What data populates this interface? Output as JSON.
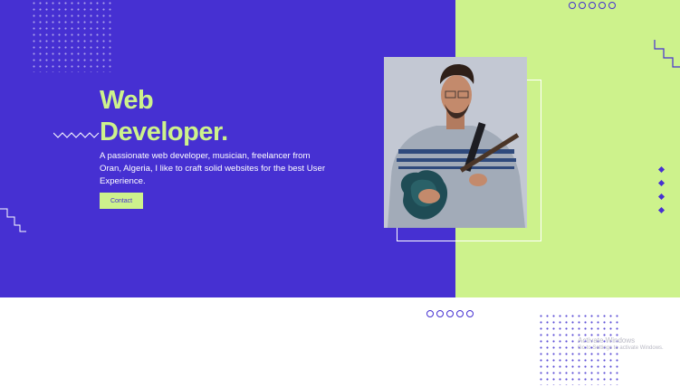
{
  "hero": {
    "title_line1": "Web",
    "title_line2": "Developer.",
    "description": "A passionate web developer, musician, freelancer from Oran, Algeria, I like to craft solid websites for the best User Experience.",
    "contact_label": "Contact"
  },
  "watermark": {
    "line1": "Activate Windows",
    "line2": "Go to Settings to activate Windows."
  },
  "colors": {
    "primary": "#4630d2",
    "accent": "#cdf28c",
    "white": "#ffffff"
  },
  "icons": {
    "ring_decor": "ring-row-decoration",
    "diamond_decor": "diamond-column-decoration",
    "zigzag_decor": "zigzag-line-decoration",
    "staircase_decor": "staircase-line-decoration"
  }
}
